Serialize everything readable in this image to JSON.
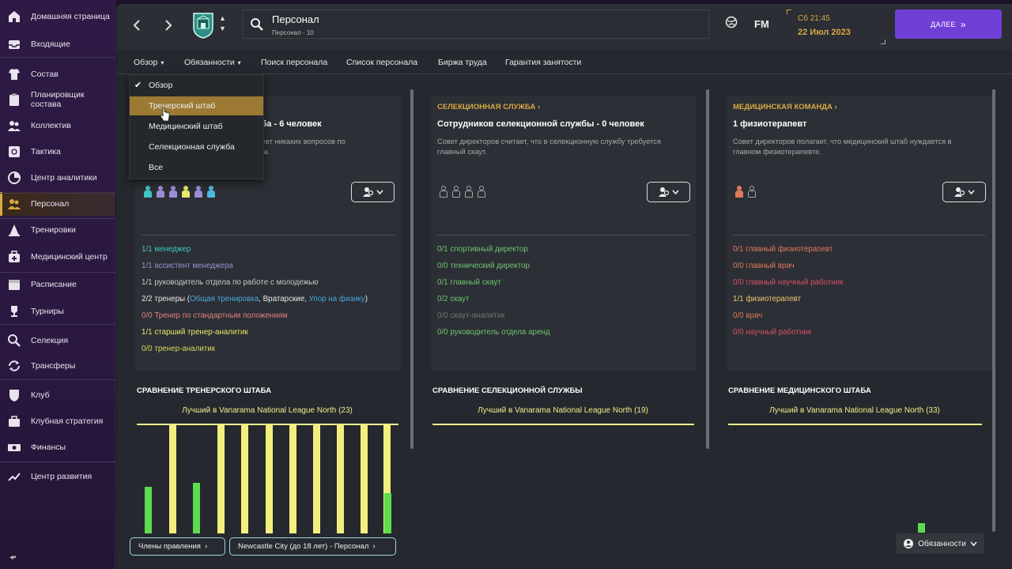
{
  "sidebar": {
    "items": [
      {
        "label": "Домашняя страница",
        "icon": "home-icon"
      },
      {
        "label": "Входящие",
        "icon": "inbox-icon"
      },
      {
        "label": "Состав",
        "icon": "squad-shirt-icon"
      },
      {
        "label": "Планировщик состава",
        "icon": "clipboard-icon"
      },
      {
        "label": "Коллектив",
        "icon": "group-icon"
      },
      {
        "label": "Тактика",
        "icon": "tactics-board-icon"
      },
      {
        "label": "Центр аналитики",
        "icon": "analytics-icon"
      },
      {
        "label": "Персонал",
        "icon": "staff-icon"
      },
      {
        "label": "Тренировки",
        "icon": "training-cone-icon"
      },
      {
        "label": "Медицинский центр",
        "icon": "medical-kit-icon"
      },
      {
        "label": "Расписание",
        "icon": "calendar-icon"
      },
      {
        "label": "Турниры",
        "icon": "trophy-icon"
      },
      {
        "label": "Селекция",
        "icon": "magnifier-icon"
      },
      {
        "label": "Трансферы",
        "icon": "transfer-arrows-icon"
      },
      {
        "label": "Клуб",
        "icon": "club-shield-icon"
      },
      {
        "label": "Клубная стратегия",
        "icon": "briefcase-icon"
      },
      {
        "label": "Финансы",
        "icon": "finance-money-icon"
      },
      {
        "label": "Центр развития",
        "icon": "development-icon"
      }
    ],
    "active_index": 7
  },
  "header": {
    "title": "Персонал",
    "subtitle": "Персонал - 10",
    "fm_label": "FM",
    "time": "Сб 21:45",
    "date": "22 Июл 2023",
    "next_label": "ДАЛЕЕ",
    "accent": "#6f3fd6"
  },
  "tabs": [
    {
      "label": "Обзор",
      "dropdown": true
    },
    {
      "label": "Обязанности",
      "dropdown": true
    },
    {
      "label": "Поиск персонала",
      "dropdown": false
    },
    {
      "label": "Список персонала",
      "dropdown": false
    },
    {
      "label": "Биржа труда",
      "dropdown": false
    },
    {
      "label": "Гарантия занятости",
      "dropdown": false
    }
  ],
  "dropdown": {
    "items": [
      "Обзор",
      "Тренерский штаб",
      "Медицинский штаб",
      "Селекционная служба",
      "Все"
    ],
    "checked_index": 0,
    "hover_index": 1,
    "hover_color": "#9c7a34"
  },
  "panels": {
    "coaching": {
      "head_visible": "таба - 6 человек",
      "desc_visible": "имеет никаких вопросов по\nтаба.",
      "roles_plain": [
        {
          "text": "1/1 менеджер",
          "color": "#3fc7c0"
        },
        {
          "text": "1/1 ассистент менеджера",
          "color": "#9a8fd4"
        },
        {
          "text": "1/1 руководитель отдела по работе с молодежью",
          "color": "#c8c8c8"
        },
        {
          "text": "0/0 Тренер по стандартным положениям",
          "color": "#e08080"
        },
        {
          "text": "1/1 старший тренер-аналитик",
          "color": "#e8e86a"
        },
        {
          "text": "0/0 тренер-аналитик",
          "color": "#d8d85a"
        }
      ],
      "roles_trainers": {
        "prefix": "2/2 тренеры (",
        "link1": "Общая тренировка",
        "sep": ", Вратарские, ",
        "link2": "Упор на физику",
        "suffix": ")"
      }
    },
    "scouting": {
      "category": "СЕЛЕКЦИОННАЯ СЛУЖБА",
      "head": "Сотрудников селекционной службы - 0 человек",
      "desc": "Совет директоров считает, что в селекционную службу требуется главный скаут.",
      "roles": [
        {
          "text": "0/1 спортивный директор",
          "color": "#6fc46f"
        },
        {
          "text": "0/0 технический директор",
          "color": "#6fc46f"
        },
        {
          "text": "0/1 главный скаут",
          "color": "#6fc46f"
        },
        {
          "text": "0/2 скаут",
          "color": "#6fc46f"
        },
        {
          "text": "0/0 скаут-аналитик",
          "color": "#6a7a6a"
        },
        {
          "text": "0/0 руководитель отдела аренд",
          "color": "#6fc46f"
        }
      ]
    },
    "medical": {
      "category": "МЕДИЦИНСКАЯ КОМАНДА",
      "head": "1 физиотерапевт",
      "desc": "Совет директоров полагает, что медицинский штаб нуждается в главном физиотерапевте.",
      "roles": [
        {
          "text": "0/1 главный физиотерапевт",
          "color": "#e07a5a"
        },
        {
          "text": "0/0 главный врач",
          "color": "#e07a5a"
        },
        {
          "text": "0/0 главный научный работник",
          "color": "#d8506a"
        },
        {
          "text": "1/1 физиотерапевт",
          "color": "#e8c870"
        },
        {
          "text": "0/0 врач",
          "color": "#e07a5a"
        },
        {
          "text": "0/0 научный работник",
          "color": "#d8506a"
        }
      ]
    }
  },
  "comparisons": [
    {
      "title": "СРАВНЕНИЕ ТРЕНЕРСКОГО ШТАБА",
      "best": "Лучший в Vanarama National League North (23)"
    },
    {
      "title": "СРАВНЕНИЕ СЕЛЕКЦИОННОЙ СЛУЖБЫ",
      "best": "Лучший в Vanarama National League North (19)"
    },
    {
      "title": "СРАВНЕНИЕ МЕДИЦИНСКОГО ШТАБА",
      "best": "Лучший в Vanarama National League North (33)"
    }
  ],
  "chart_data": {
    "type": "bar",
    "values": [
      0.43,
      1.0,
      0.47,
      1.0,
      1.0,
      1.0,
      1.0,
      1.0,
      1.0,
      1.0,
      1.0,
      0.37
    ],
    "colors": [
      "#5ddc4e",
      "#f3ef7e",
      "#5ddc4e",
      "#f3ef7e",
      "#f3ef7e",
      "#f3ef7e",
      "#f3ef7e",
      "#f3ef7e",
      "#f3ef7e",
      "#f3ef7e",
      "#f3ef7e",
      "#5ddc4e"
    ],
    "ylim": [
      0,
      1
    ]
  },
  "pills": {
    "board": "Члены правления",
    "youth": "Newcastle City (до 18 лет) - Персонал"
  },
  "responsibilities_button": "Обязанности"
}
